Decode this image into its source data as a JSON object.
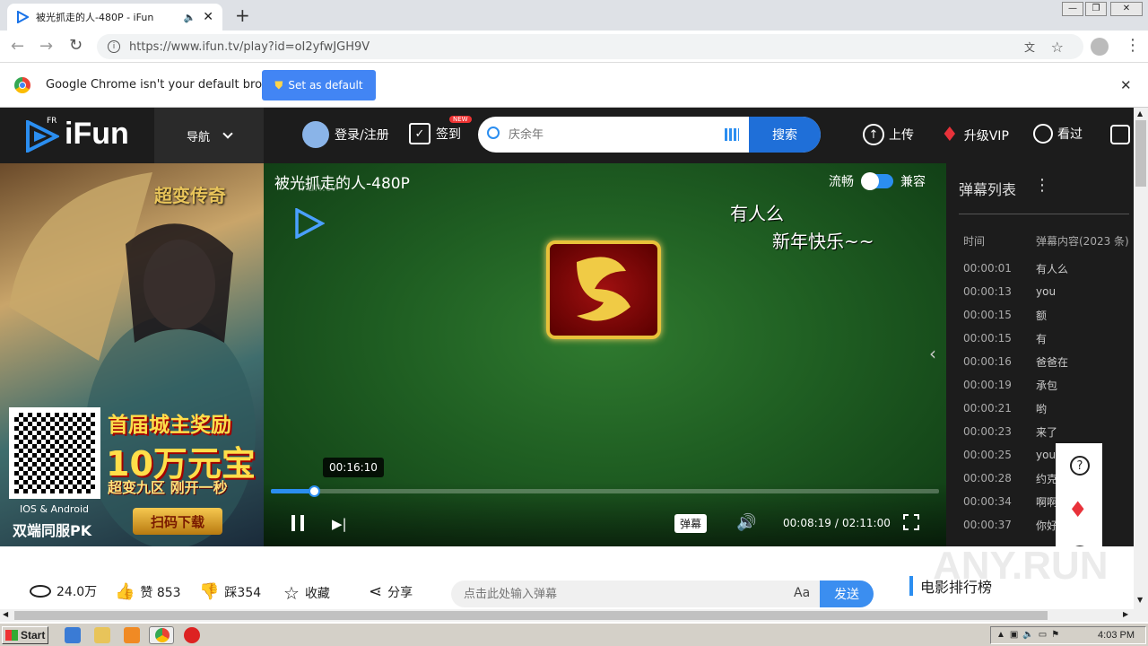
{
  "browser": {
    "tab_title": "被光抓走的人-480P - iFun",
    "new_tab_symbol": "+",
    "url": "https://www.ifun.tv/play?id=oI2yfwJGH9V",
    "infobar_text": "Google Chrome isn't your default browser",
    "set_default_label": "Set as default"
  },
  "site": {
    "logo_text": "iFun",
    "logo_badge": "FR",
    "nav_label": "导航",
    "login_label": "登录/注册",
    "checkin_label": "签到",
    "checkin_badge": "NEW",
    "search_placeholder": "庆余年",
    "search_button": "搜索",
    "upload_label": "上传",
    "vip_label": "升级VIP",
    "history_label": "看过"
  },
  "ad": {
    "title": "超变传奇",
    "headline1": "首届城主奖励",
    "headline2": "10万元宝",
    "headline3": "超变九区 刚开一秒",
    "platform": "IOS & Android",
    "platform2": "双端同服PK",
    "download": "扫码下载"
  },
  "player": {
    "title": "被光抓走的人-480P",
    "watermark": "iFun.tv",
    "mode_smooth": "流畅",
    "mode_compat": "兼容",
    "danmaku_1": "有人么",
    "danmaku_2": "新年快乐~~",
    "hover_time": "00:16:10",
    "progress": 0.065,
    "danmaku_button": "弹幕",
    "current_time": "00:08:19",
    "time_separator": "/",
    "total_time": "02:11:00"
  },
  "sidebar": {
    "title": "弹幕列表",
    "col_time": "时间",
    "col_content": "弹幕内容(2023 条)",
    "rows": [
      {
        "time": "00:00:01",
        "content": "有人么"
      },
      {
        "time": "00:00:13",
        "content": "you"
      },
      {
        "time": "00:00:15",
        "content": "额"
      },
      {
        "time": "00:00:15",
        "content": "有"
      },
      {
        "time": "00:00:16",
        "content": "爸爸在"
      },
      {
        "time": "00:00:19",
        "content": "承包"
      },
      {
        "time": "00:00:21",
        "content": "哟"
      },
      {
        "time": "00:00:23",
        "content": "来了"
      },
      {
        "time": "00:00:25",
        "content": "you"
      },
      {
        "time": "00:00:28",
        "content": "约克"
      },
      {
        "time": "00:00:34",
        "content": "啊啊"
      },
      {
        "time": "00:00:37",
        "content": "你好"
      }
    ]
  },
  "stats": {
    "views": "24.0万",
    "likes": "赞 853",
    "dislikes": "踩354",
    "favorite": "收藏",
    "share": "分享",
    "danmaku_placeholder": "点击此处输入弹幕",
    "font_button": "Aa",
    "send_button": "发送",
    "ranking_title": "电影排行榜"
  },
  "taskbar": {
    "start": "Start",
    "clock": "4:03 PM"
  },
  "watermark": "ANY.RUN"
}
